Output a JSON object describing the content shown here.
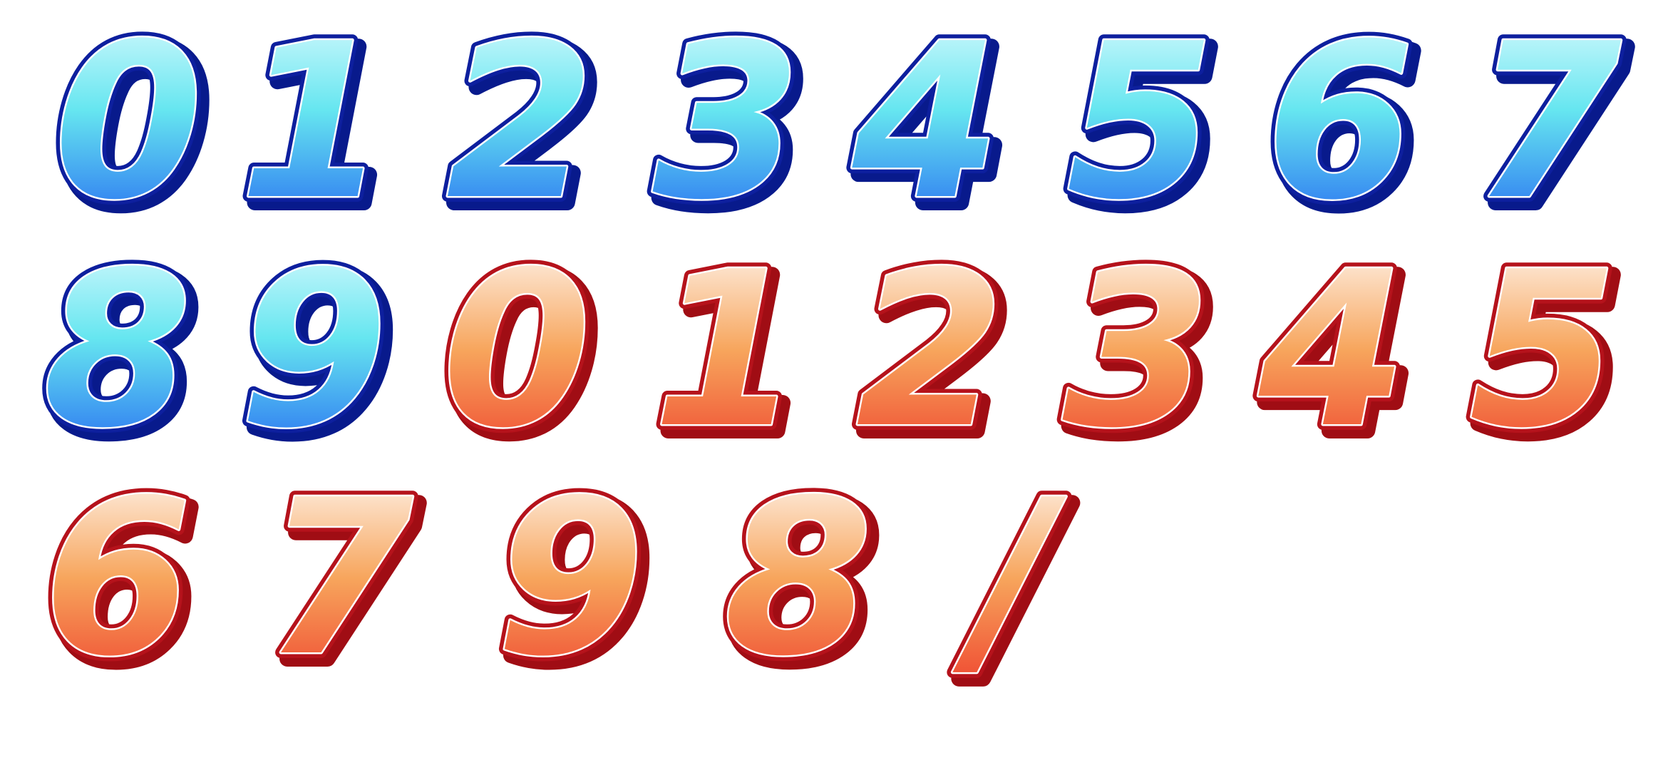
{
  "sheet": {
    "background": "#ffffff",
    "themes": {
      "blue": {
        "outline": "#0d1f9e",
        "shadow": "#081a8c",
        "gradient_top": "#e6fcff",
        "gradient_mid": "#66e6f0",
        "gradient_bottom": "#1f5cf2",
        "shine": "#ffffff"
      },
      "red": {
        "outline": "#b5121b",
        "shadow": "#a00d14",
        "gradient_top": "#ffffff",
        "gradient_mid": "#f7a55c",
        "gradient_bottom": "#ee3a2a",
        "shine": "#ffffff"
      }
    },
    "rows": [
      {
        "glyphs": [
          {
            "char": "0",
            "theme": "blue"
          },
          {
            "char": "1",
            "theme": "blue"
          },
          {
            "char": "2",
            "theme": "blue"
          },
          {
            "char": "3",
            "theme": "blue"
          },
          {
            "char": "4",
            "theme": "blue"
          },
          {
            "char": "5",
            "theme": "blue"
          },
          {
            "char": "6",
            "theme": "blue"
          },
          {
            "char": "7",
            "theme": "blue"
          }
        ]
      },
      {
        "glyphs": [
          {
            "char": "8",
            "theme": "blue"
          },
          {
            "char": "9",
            "theme": "blue"
          },
          {
            "char": "0",
            "theme": "red"
          },
          {
            "char": "1",
            "theme": "red"
          },
          {
            "char": "2",
            "theme": "red"
          },
          {
            "char": "3",
            "theme": "red"
          },
          {
            "char": "4",
            "theme": "red"
          },
          {
            "char": "5",
            "theme": "red"
          }
        ]
      },
      {
        "glyphs": [
          {
            "char": "6",
            "theme": "red"
          },
          {
            "char": "7",
            "theme": "red"
          },
          {
            "char": "9",
            "theme": "red"
          },
          {
            "char": "8",
            "theme": "red"
          },
          {
            "char": "/",
            "theme": "red"
          }
        ]
      }
    ]
  }
}
